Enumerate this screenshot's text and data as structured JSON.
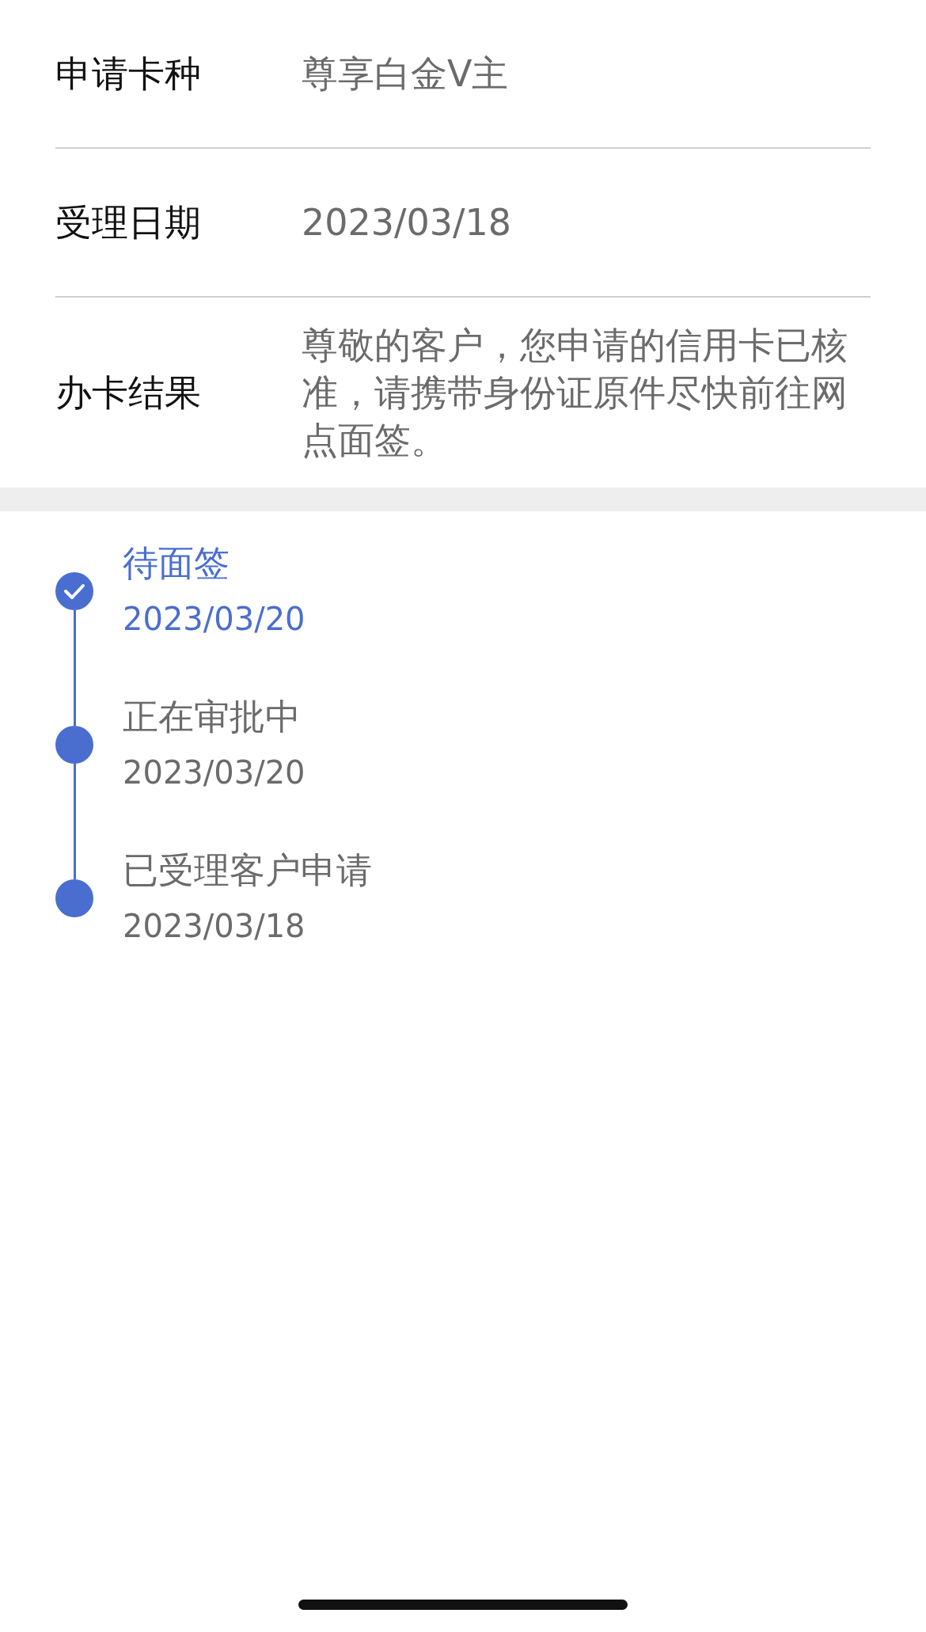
{
  "details": [
    {
      "label": "申请卡种",
      "value": "尊享白金V主"
    },
    {
      "label": "受理日期",
      "value": "2023/03/18"
    },
    {
      "label": "办卡结果",
      "value": "尊敬的客户，您申请的信用卡已核准，请携带身份证原件尽快前往网点面签。"
    }
  ],
  "timeline": [
    {
      "title": "待面签",
      "date": "2023/03/20",
      "selected": true
    },
    {
      "title": "正在审批中",
      "date": "2023/03/20",
      "selected": false
    },
    {
      "title": "已受理客户申请",
      "date": "2023/03/18",
      "selected": false
    }
  ]
}
